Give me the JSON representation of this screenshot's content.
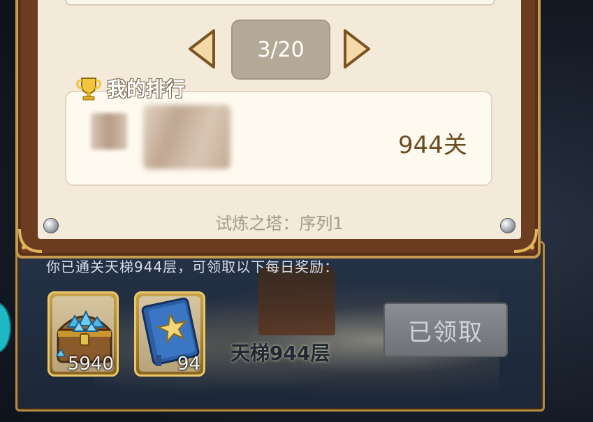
{
  "dialog": {
    "pagination": {
      "current": "3/20"
    },
    "my_rank": {
      "title": "我的排行",
      "value": "944关"
    },
    "tower_label": "试炼之塔：序列1"
  },
  "reward": {
    "description": "你已通关天梯944层，可领取以下每日奖励：",
    "items": [
      {
        "icon": "treasure-chest-icon",
        "count": "5940"
      },
      {
        "icon": "book-icon",
        "count": "94"
      }
    ],
    "floor_label": "天梯944层",
    "claim_button": "已领取"
  },
  "colors": {
    "frame_brown": "#6b3c1f",
    "frame_gold": "#c79b4e",
    "parchment": "#f3ead9",
    "rank_value": "#6a4a1e",
    "button_disabled": "#7d8085"
  }
}
